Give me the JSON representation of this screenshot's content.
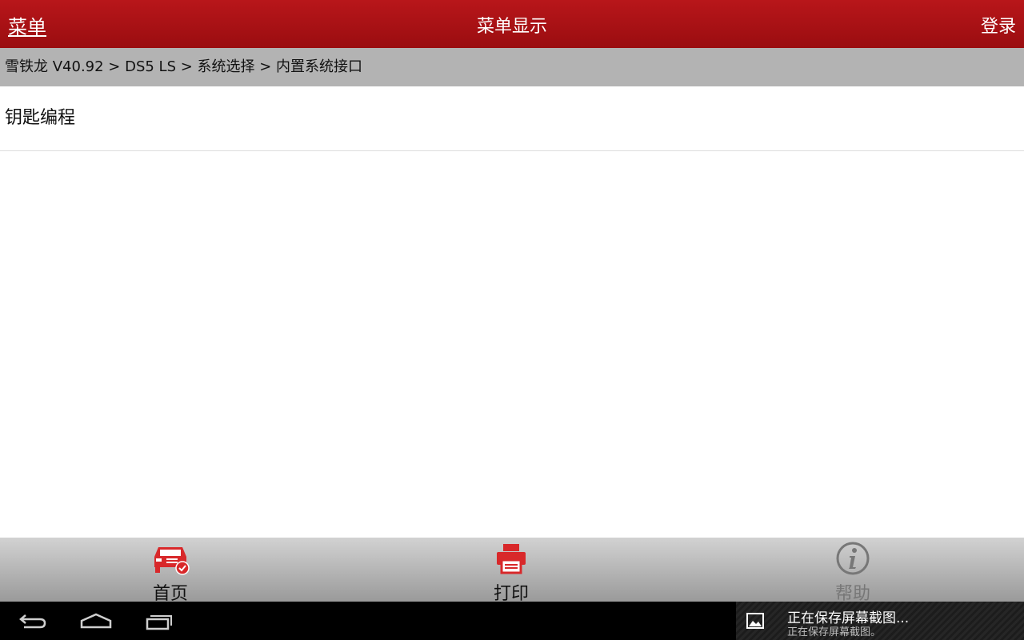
{
  "header": {
    "menu_label": "菜单",
    "title": "菜单显示",
    "login_label": "登录"
  },
  "breadcrumb": {
    "path": "雪铁龙 V40.92 > DS5 LS > 系统选择 > 内置系统接口"
  },
  "list": {
    "items": [
      {
        "label": "钥匙编程"
      }
    ]
  },
  "toolbar": {
    "home_label": "首页",
    "print_label": "打印",
    "help_label": "帮助",
    "accent_color": "#d8282a",
    "disabled_color": "#777777"
  },
  "system_nav": {
    "back_icon": "back-icon",
    "home_icon": "home-icon",
    "recents_icon": "recents-icon"
  },
  "notification": {
    "title": "正在保存屏幕截图...",
    "subtitle": "正在保存屏幕截图。"
  }
}
